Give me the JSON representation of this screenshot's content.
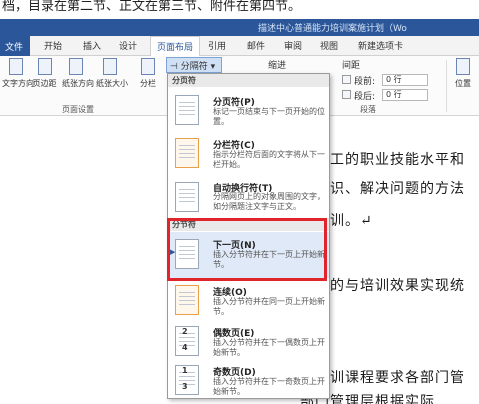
{
  "caption": "档，目录在第二节、正文在第三节、附件在第四节。",
  "window_title": "描述中心普通能力培训案施计划（Wo",
  "tabs": {
    "file": "文件",
    "home": "开始",
    "insert": "插入",
    "design": "设计",
    "page_layout": "页面布局",
    "references": "引用",
    "mailings": "邮件",
    "review": "审阅",
    "view": "视图",
    "new_tab": "新建选项卡"
  },
  "ribbon": {
    "text_direction": "文字方向",
    "margins": "页边距",
    "orientation": "纸张方向",
    "size": "纸张大小",
    "columns": "分栏",
    "breaks": "分隔符",
    "indent": "缩进",
    "spacing": "间距",
    "before_label": "段前:",
    "before_value": "0 行",
    "after_label": "段后:",
    "after_value": "0 行",
    "group_page_setup": "页面设置",
    "group_paragraph": "段落",
    "position": "位置"
  },
  "dropdown": {
    "section_page_breaks": "分页符",
    "section_section_breaks": "分节符",
    "items": [
      {
        "title": "分页符(P)",
        "desc": "标记一页结束与下一页开始的位置。"
      },
      {
        "title": "分栏符(C)",
        "desc": "指示分栏符后面的文字将从下一栏开始。"
      },
      {
        "title": "自动换行符(T)",
        "desc": "分隔网页上的对象周围的文字，如分隔题注文字与正文。"
      },
      {
        "title": "下一页(N)",
        "desc": "插入分节符并在下一页上开始新节。"
      },
      {
        "title": "连续(O)",
        "desc": "插入分节符并在同一页上开始新节。"
      },
      {
        "title": "偶数页(E)",
        "desc": "插入分节符并在下一偶数页上开始新节。",
        "page_num": "2",
        "page_num2": "4"
      },
      {
        "title": "奇数页(D)",
        "desc": "插入分节符并在下一奇数页上开始新节。",
        "page_num": "1",
        "page_num2": "3"
      }
    ]
  },
  "document": {
    "line1": "心员工的职业技能水平和",
    "line2": "的知识、解决问题的方法",
    "line3": "项培训。↵",
    "line4": "训目的与培训效果实现统",
    "line5": "分培训课程要求各部门管",
    "line6": "部门管理层根据实际"
  },
  "colors": {
    "accent": "#2b579a",
    "highlight_box": "#e0242b"
  }
}
